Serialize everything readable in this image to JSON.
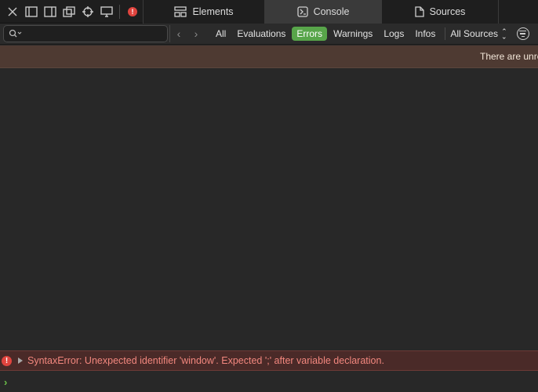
{
  "toolbar": {
    "tools": [
      {
        "icon": "close-icon"
      },
      {
        "icon": "dock-left-icon"
      },
      {
        "icon": "dock-right-icon"
      },
      {
        "icon": "undock-icon"
      },
      {
        "icon": "crosshair-icon"
      },
      {
        "icon": "device-icon"
      }
    ],
    "error_indicator": "!"
  },
  "tabs": [
    {
      "label": "Elements",
      "icon": "elements-icon",
      "active": false
    },
    {
      "label": "Console",
      "icon": "console-icon",
      "active": true
    },
    {
      "label": "Sources",
      "icon": "document-icon",
      "active": false
    }
  ],
  "filterbar": {
    "search_placeholder": "",
    "search_value": "",
    "filters": [
      {
        "label": "All",
        "active": false
      },
      {
        "label": "Evaluations",
        "active": false
      },
      {
        "label": "Errors",
        "active": true
      },
      {
        "label": "Warnings",
        "active": false
      },
      {
        "label": "Logs",
        "active": false
      },
      {
        "label": "Infos",
        "active": false
      }
    ],
    "sources_label": "All Sources",
    "sources_icon": "⌃⌄"
  },
  "banner": {
    "text": "There are unre"
  },
  "console": {
    "error_icon": "!",
    "error_message": "SyntaxError: Unexpected identifier 'window'. Expected ';' after variable declaration.",
    "prompt_symbol": "›",
    "prompt_value": ""
  },
  "colors": {
    "active_filter": "#58a54a",
    "banner_bg": "#4e3a32",
    "error_bg": "#4a2a28",
    "error_text": "#f2877e",
    "prompt": "#6cc24a"
  }
}
